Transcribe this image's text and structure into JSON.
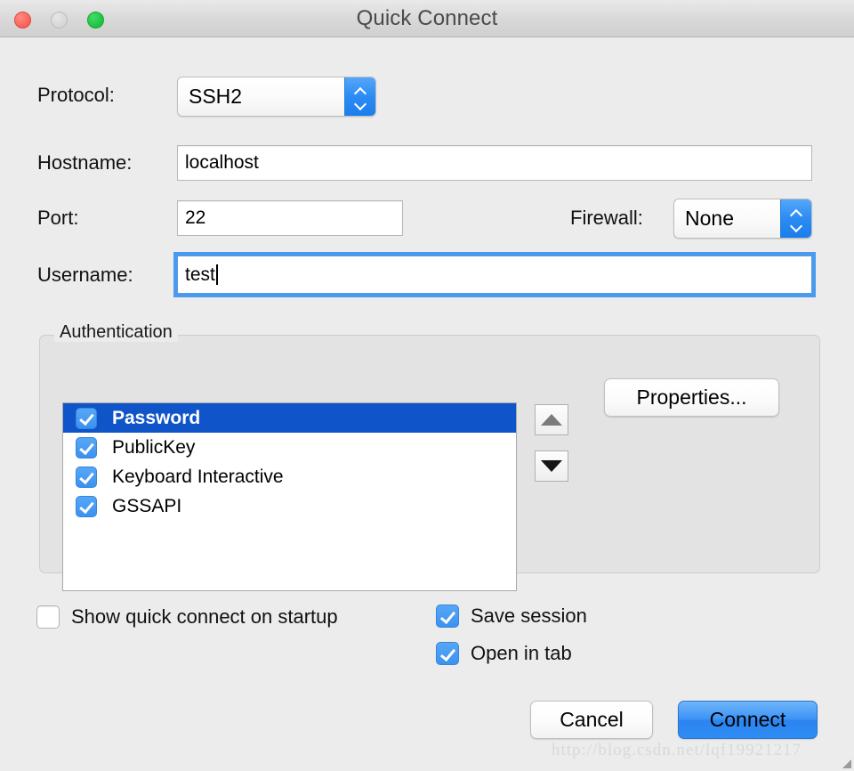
{
  "window": {
    "title": "Quick Connect",
    "traffic_lights": [
      {
        "name": "close",
        "color": "#fa5f55",
        "enabled": true
      },
      {
        "name": "minimize",
        "color": "#d6d6d6",
        "enabled": false
      },
      {
        "name": "zoom",
        "color": "#1dc23f",
        "enabled": true
      }
    ]
  },
  "form": {
    "protocol": {
      "label": "Protocol:",
      "value": "SSH2"
    },
    "hostname": {
      "label": "Hostname:",
      "value": "localhost",
      "placeholder": ""
    },
    "port": {
      "label": "Port:",
      "value": "22",
      "placeholder": ""
    },
    "firewall": {
      "label": "Firewall:",
      "value": "None"
    },
    "username": {
      "label": "Username:",
      "value": "test",
      "placeholder": "",
      "focused": true
    }
  },
  "authentication": {
    "legend": "Authentication",
    "items": [
      {
        "label": "Password",
        "checked": true,
        "selected": true
      },
      {
        "label": "PublicKey",
        "checked": true,
        "selected": false
      },
      {
        "label": "Keyboard Interactive",
        "checked": true,
        "selected": false
      },
      {
        "label": "GSSAPI",
        "checked": true,
        "selected": false
      }
    ],
    "move_up_label": "▲",
    "move_down_label": "▼",
    "properties_label": "Properties..."
  },
  "options": {
    "show_on_startup": {
      "label": "Show quick connect on startup",
      "checked": false
    },
    "save_session": {
      "label": "Save session",
      "checked": true
    },
    "open_in_tab": {
      "label": "Open in tab",
      "checked": true
    }
  },
  "actions": {
    "cancel_label": "Cancel",
    "connect_label": "Connect"
  },
  "watermark": "http://blog.csdn.net/lqf19921217",
  "colors": {
    "accent_blue": "#3b92f0",
    "selection_blue": "#0f54c9",
    "focus_ring": "#4a9bf0",
    "window_bg": "#ececec",
    "group_bg": "#e3e3e3"
  }
}
